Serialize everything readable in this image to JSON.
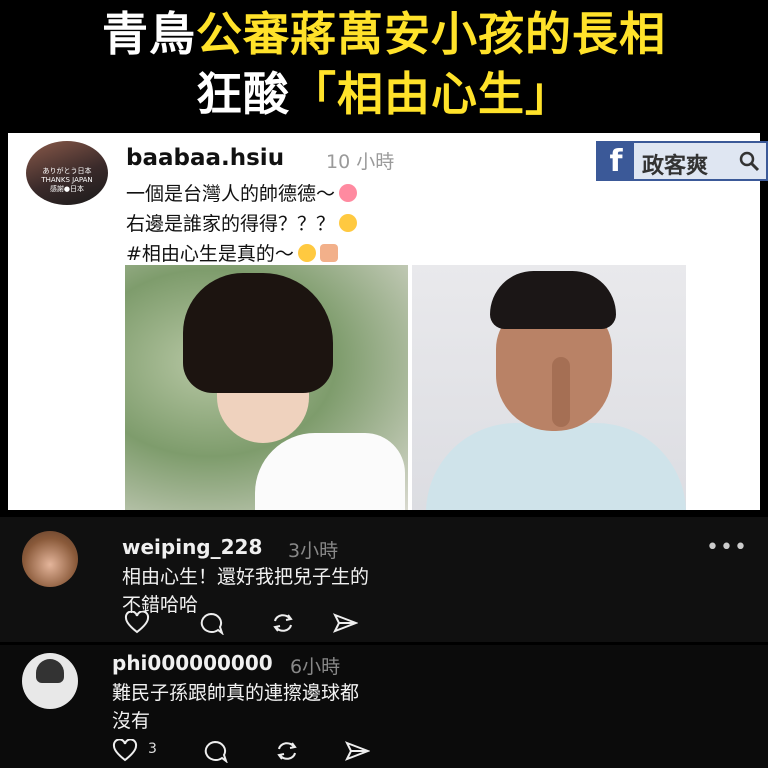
{
  "headline": {
    "line1_white": "青鳥",
    "line1_yellow": "公審蔣萬安小孩的長相",
    "line2_white": "狂酸",
    "line2_yellow": "「相由心生」"
  },
  "post": {
    "username": "baabaa.hsiu",
    "time": "10 小時",
    "avatar_caption": "ありがとう日本\nTHANKS JAPAN\n感謝●日本",
    "lines": [
      "一個是台灣人的帥德德～",
      "右邊是誰家的得得？？？",
      "#相由心生是真的～"
    ]
  },
  "badge": {
    "f_letter": "f",
    "site_name": "政客爽",
    "icon": "magnifier-icon"
  },
  "comments": [
    {
      "username": "weiping_228",
      "time": "3小時",
      "text_line1": "相由心生！還好我把兒子生的",
      "text_line2": "不錯哈哈",
      "more": "•••"
    },
    {
      "username": "phi000000000",
      "time": "6小時",
      "text_line1": "難民子孫跟帥真的連擦邊球都",
      "text_line2": "沒有",
      "like_count": "3"
    }
  ],
  "icons": [
    "heart-icon",
    "comment-icon",
    "repost-icon",
    "share-icon"
  ],
  "colors": {
    "headline_yellow": "#ffe22a",
    "facebook_blue": "#3b5998"
  }
}
